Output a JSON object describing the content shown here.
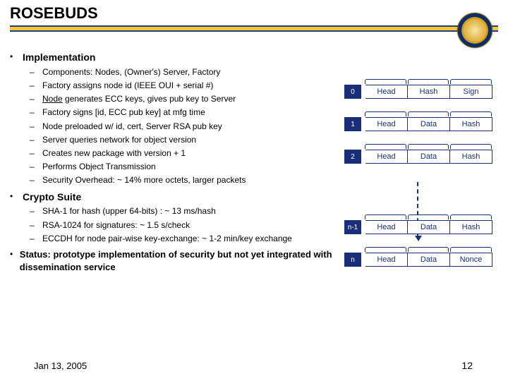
{
  "title": "ROSEBUDS",
  "sections": [
    {
      "label": "Implementation",
      "items": [
        {
          "text": "Components: Nodes, (Owner's) Server, Factory"
        },
        {
          "text": "Factory assigns node id (IEEE OUI + serial #)"
        },
        {
          "underline": "Node",
          "rest": " generates ECC keys, gives pub key to Server"
        },
        {
          "text": "Factory signs [id, ECC pub key] at mfg time"
        },
        {
          "text": "Node preloaded w/ id, cert, Server RSA pub key"
        },
        {
          "text": "Server queries network for object version"
        },
        {
          "text": "Creates new package with version + 1"
        },
        {
          "text": "Performs Object Transmission"
        },
        {
          "text": "Security Overhead: ~ 14% more octets, larger packets"
        }
      ]
    },
    {
      "label": "Crypto Suite",
      "items": [
        {
          "text": "SHA-1 for hash (upper 64-bits) : ~ 13 ms/hash"
        },
        {
          "text": "RSA-1024 for signatures: ~ 1.5 s/check"
        },
        {
          "text": "ECCDH for node pair-wise key-exchange: ~ 1-2 min/key exchange"
        }
      ]
    },
    {
      "label": "Status: prototype implementation of security but not yet integrated with dissemination service",
      "items": []
    }
  ],
  "packets": [
    {
      "idx": "0",
      "c1": "Head",
      "c2": "Hash",
      "c3": "Sign"
    },
    {
      "idx": "1",
      "c1": "Head",
      "c2": "Data",
      "c3": "Hash"
    },
    {
      "idx": "2",
      "c1": "Head",
      "c2": "Data",
      "c3": "Hash"
    },
    {
      "idx": "n-1",
      "c1": "Head",
      "c2": "Data",
      "c3": "Hash"
    },
    {
      "idx": "n",
      "c1": "Head",
      "c2": "Data",
      "c3": "Nonce"
    }
  ],
  "footer": {
    "date": "Jan 13, 2005",
    "page": "12"
  }
}
